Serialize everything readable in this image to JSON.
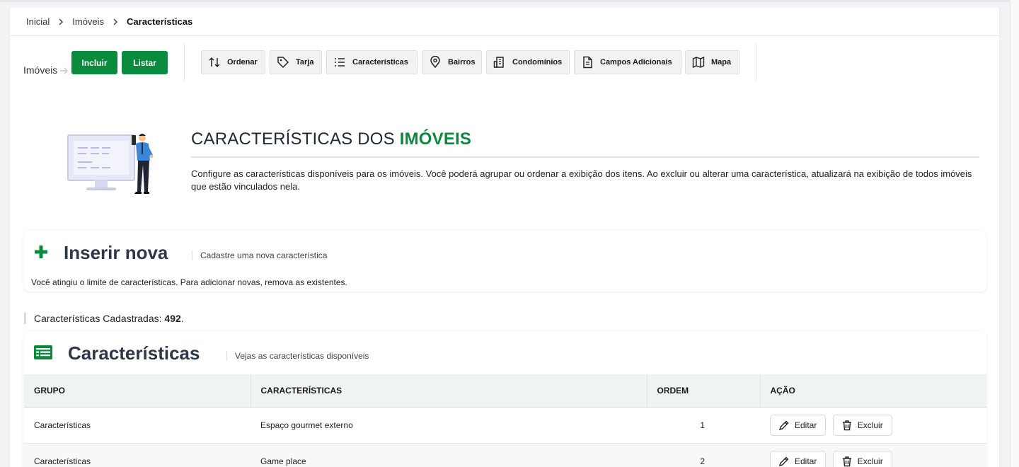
{
  "breadcrumb": {
    "items": [
      "Inicial",
      "Imóveis"
    ],
    "current": "Características"
  },
  "toolbar": {
    "label": "Imóveis",
    "include_label": "Incluir",
    "list_label": "Listar",
    "tools": {
      "ordenar": "Ordenar",
      "tarja": "Tarja",
      "caracteristicas": "Características",
      "bairros": "Bairros",
      "condominios": "Condomínios",
      "campos": "Campos Adicionais",
      "mapa": "Mapa"
    }
  },
  "hero": {
    "title_prefix": "CARACTERÍSTICAS DOS ",
    "title_accent": "IMÓVEIS",
    "description": "Configure as características disponíveis para os imóveis. Você poderá agrupar ou ordenar a exibição dos itens. Ao excluir ou alterar uma característica, atualizará na exibição de todos imóveis que estão vinculados nela."
  },
  "insert": {
    "title": "Inserir nova",
    "subtitle": "Cadastre uma nova característica",
    "note": "Você atingiu o limite de características. Para adicionar novas, remova as existentes."
  },
  "count": {
    "label": "Características Cadastradas: ",
    "value": "492",
    "suffix": "."
  },
  "list": {
    "title": "Características",
    "subtitle": "Vejas as características disponíveis",
    "columns": {
      "group": "GRUPO",
      "feature": "CARACTERÍSTICAS",
      "order": "ORDEM",
      "action": "AÇÃO"
    },
    "rows": [
      {
        "group": "Características",
        "feature": "Espaço gourmet externo",
        "order": "1"
      },
      {
        "group": "Características",
        "feature": "Game place",
        "order": "2"
      }
    ],
    "edit_label": "Editar",
    "delete_label": "Excluir"
  },
  "colors": {
    "brand_green": "#0a8a3c",
    "header_row": "#eff4f1"
  }
}
